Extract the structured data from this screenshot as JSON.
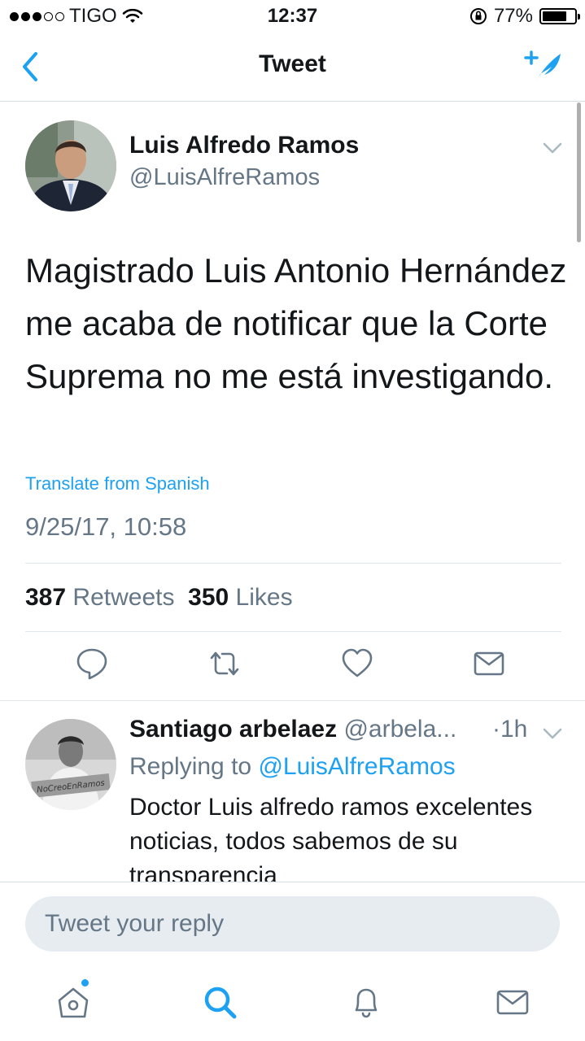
{
  "status_bar": {
    "carrier": "TIGO",
    "time": "12:37",
    "battery_pct": "77%",
    "battery_level": 0.77,
    "signal_bars": 3
  },
  "nav": {
    "title": "Tweet",
    "back_icon": "chevron-left-icon",
    "compose_icon": "compose-tweet-icon"
  },
  "tweet": {
    "author_name": "Luis Alfredo Ramos",
    "author_handle": "@LuisAlfreRamos",
    "text": "Magistrado Luis Antonio Hernández me acaba de notificar que la Corte Suprema no me está investigando.",
    "translate_label": "Translate from Spanish",
    "timestamp": "9/25/17, 10:58",
    "retweets_count": "387",
    "retweets_label": "Retweets",
    "likes_count": "350",
    "likes_label": "Likes"
  },
  "reply": {
    "author_name": "Santiago arbelaez",
    "author_handle": "@arbela...",
    "time": "·1h",
    "replying_prefix": "Replying to",
    "replying_handle": "@LuisAlfreRamos",
    "text": "Doctor Luis alfredo ramos excelentes noticias, todos sabemos de su transparencia"
  },
  "composer": {
    "placeholder": "Tweet your reply"
  },
  "colors": {
    "accent": "#1da1f2",
    "secondary_text": "#657786",
    "primary_text": "#14171a",
    "divider": "#e1e8ed"
  }
}
